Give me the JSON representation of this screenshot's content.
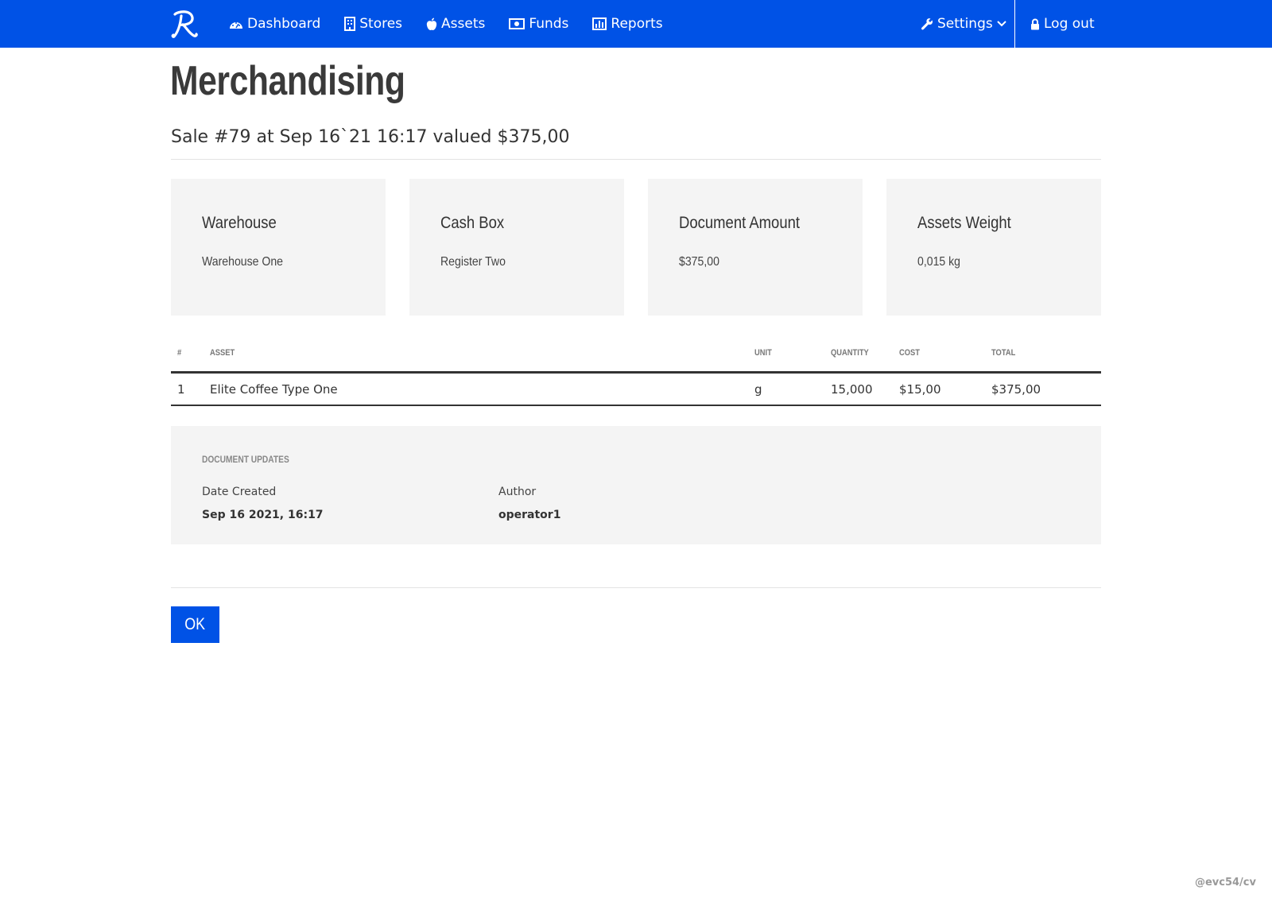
{
  "nav": {
    "items": [
      {
        "label": "Dashboard",
        "icon": "dashboard-icon"
      },
      {
        "label": "Stores",
        "icon": "building-icon"
      },
      {
        "label": "Assets",
        "icon": "apple-icon"
      },
      {
        "label": "Funds",
        "icon": "money-icon"
      },
      {
        "label": "Reports",
        "icon": "bar-chart-icon"
      }
    ],
    "settings_label": "Settings",
    "logout_label": "Log out"
  },
  "page": {
    "title": "Merchandising",
    "subtitle": "Sale #79 at Sep 16`21 16:17 valued $375,00"
  },
  "cards": [
    {
      "label": "Warehouse",
      "value": "Warehouse One"
    },
    {
      "label": "Cash Box",
      "value": "Register Two"
    },
    {
      "label": "Document Amount",
      "value": "$375,00"
    },
    {
      "label": "Assets Weight",
      "value": "0,015 kg"
    }
  ],
  "table": {
    "headers": {
      "num": "#",
      "asset": "ASSET",
      "unit": "UNIT",
      "quantity": "QUANTITY",
      "cost": "COST",
      "total": "TOTAL"
    },
    "rows": [
      {
        "num": "1",
        "asset": "Elite Coffee Type One",
        "unit": "g",
        "quantity": "15,000",
        "cost": "$15,00",
        "total": "$375,00"
      }
    ]
  },
  "updates": {
    "title": "DOCUMENT UPDATES",
    "date_created_label": "Date Created",
    "date_created_value": "Sep 16 2021, 16:17",
    "author_label": "Author",
    "author_value": "operator1"
  },
  "ok_label": "OK",
  "watermark": "@evc54/cv",
  "colors": {
    "brand": "#0052e6",
    "card_bg": "#f4f4f4"
  }
}
